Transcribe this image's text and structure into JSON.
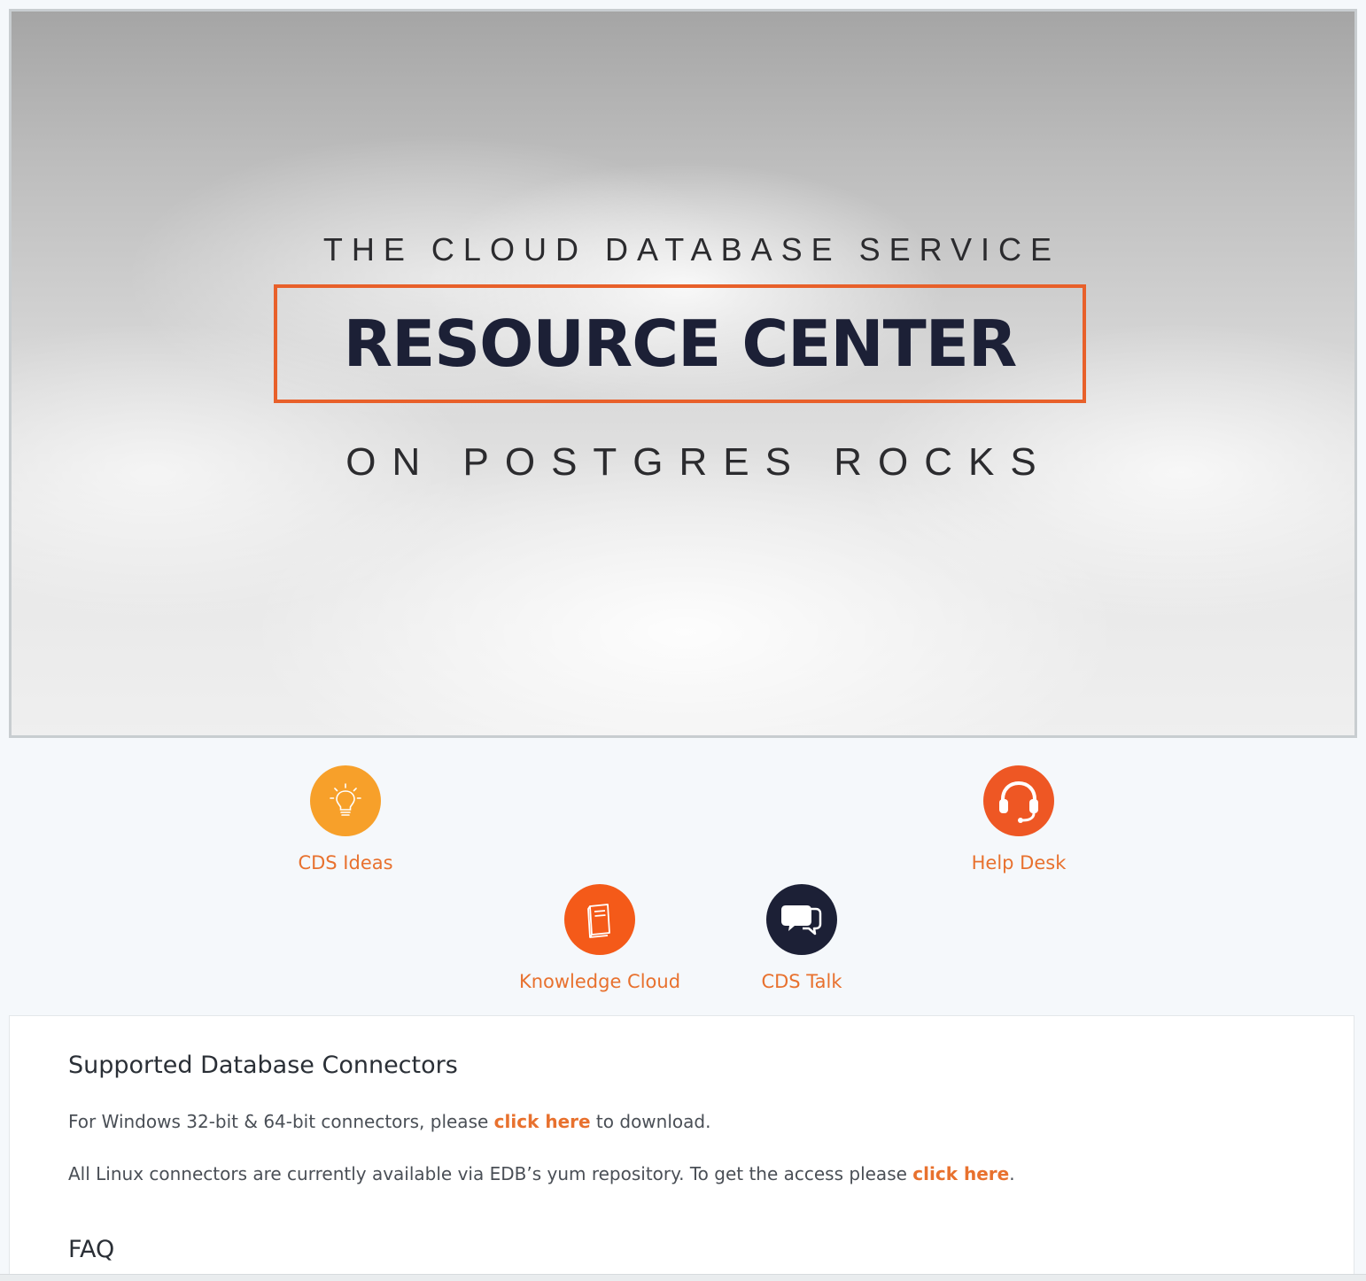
{
  "hero": {
    "line_top": "THE CLOUD DATABASE SERVICE",
    "title": "RESOURCE CENTER",
    "line_bottom": "ON POSTGRES ROCKS",
    "accent_color": "#e8602a",
    "title_color": "#1c2036"
  },
  "quick_links": {
    "ideas": {
      "label": "CDS Ideas",
      "icon": "lightbulb-icon",
      "color": "#f7a02a"
    },
    "help": {
      "label": "Help Desk",
      "icon": "headset-icon",
      "color": "#ee5724"
    },
    "knowledge": {
      "label": "Knowledge Cloud",
      "icon": "book-icon",
      "color": "#f45a19"
    },
    "talk": {
      "label": "CDS Talk",
      "icon": "chat-bubbles-icon",
      "color": "#1c2036"
    }
  },
  "connectors": {
    "heading": "Supported Database Connectors",
    "windows_before": "For Windows 32-bit & 64-bit connectors, please ",
    "windows_link": "click here",
    "windows_after": " to download.",
    "linux_before": "All Linux connectors are currently available via EDB’s yum repository. To get the access please ",
    "linux_link": "click here",
    "linux_after": "."
  },
  "faq": {
    "heading": "FAQ"
  },
  "link_color": "#e8712e"
}
